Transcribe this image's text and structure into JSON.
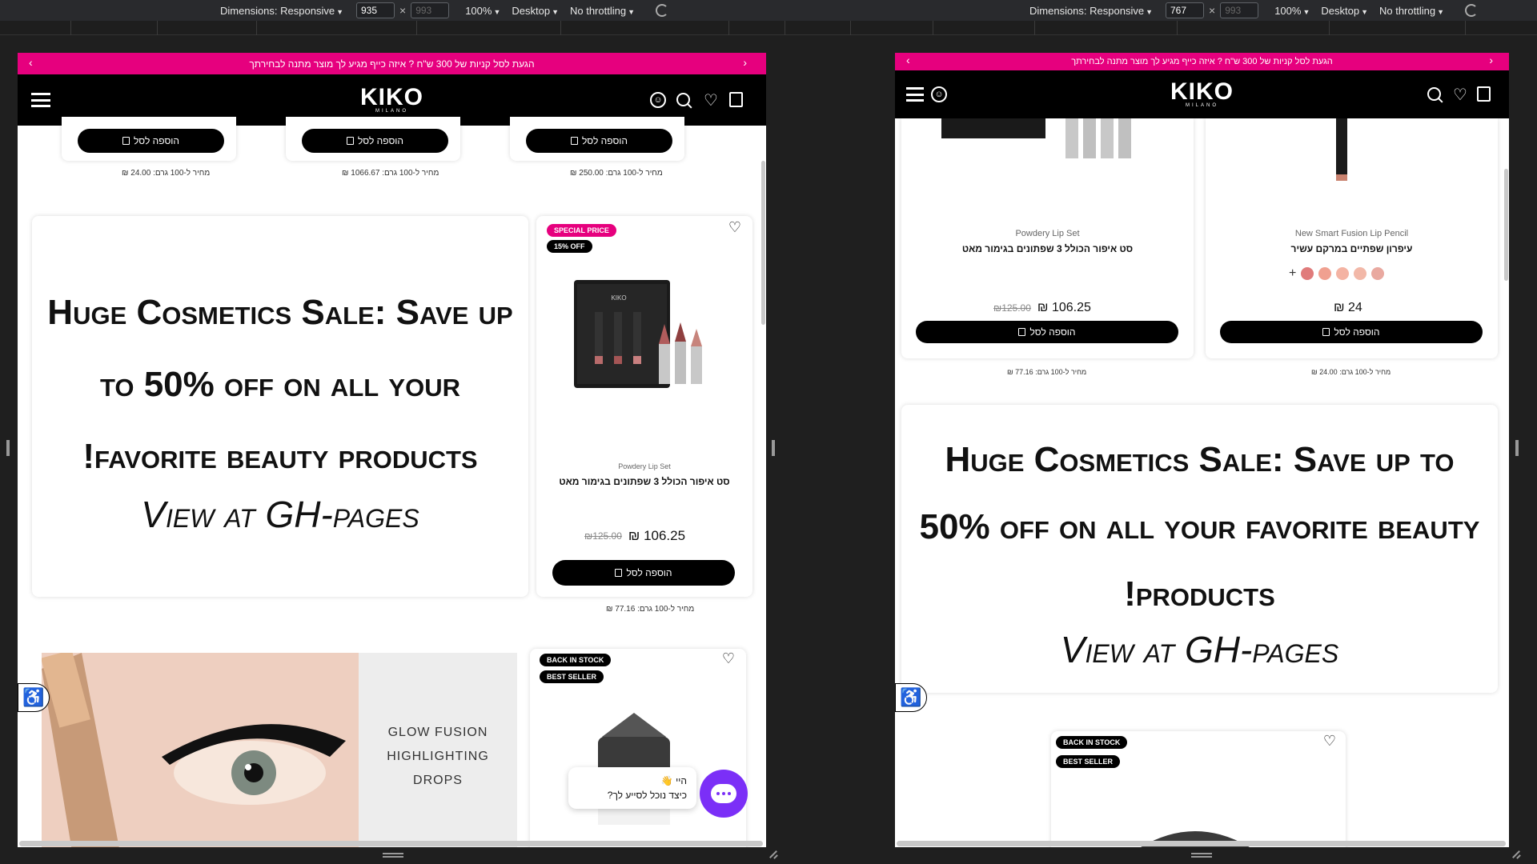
{
  "devtools": {
    "left": {
      "dimensions_label": "Dimensions: Responsive",
      "width": "935",
      "height": "993",
      "zoom": "100%",
      "device": "Desktop",
      "throttling": "No throttling"
    },
    "right": {
      "dimensions_label": "Dimensions: Responsive",
      "width": "767",
      "height": "993",
      "zoom": "100%",
      "device": "Desktop",
      "throttling": "No throttling"
    }
  },
  "site": {
    "promo_text": "הגעת לסל קניות של 300 ש\"ח ? איזה כייף מגיע לך מוצר מתנה לבחירתך",
    "logo": "KIKO",
    "logo_sub": "MILANO",
    "add_to_cart": "הוספה לסל",
    "banner_headline": "Huge Cosmetics Sale: Save up to 50% off on all your favorite beauty products!",
    "banner_link": "View at GH-pages",
    "badges": {
      "special_price": "SPECIAL PRICE",
      "off": "15% OFF",
      "back_in_stock": "BACK IN STOCK",
      "best_seller": "BEST SELLER"
    },
    "chat_greeting_line1": "היי 👋",
    "chat_greeting_line2": "כיצד נוכל לסייע לך?",
    "glow_line1": "GLOW FUSION",
    "glow_line2": "HIGHLIGHTING",
    "glow_line3": "DROPS",
    "accessibility_icon": "wheelchair-icon"
  },
  "left_view": {
    "top_unit_prices": [
      "מחיר ל-100 גרם: 24.00 ₪",
      "מחיר ל-100 גרם: 1066.67 ₪",
      "מחיר ל-100 גרם: 250.00 ₪"
    ],
    "product": {
      "sub_name": "Powdery Lip Set",
      "name": "סט איפור הכולל 3 שפתונים בגימור מאט",
      "old_price": "₪125.00",
      "new_price": "₪ 106.25",
      "unit_price": "מחיר ל-100 גרם: 77.16 ₪"
    }
  },
  "right_view": {
    "products": [
      {
        "sub_name": "Powdery Lip Set",
        "name": "סט איפור הכולל 3 שפתונים בגימור מאט",
        "old_price": "₪125.00",
        "new_price": "₪ 106.25",
        "unit_price": "מחיר ל-100 גרם: 77.16 ₪"
      },
      {
        "sub_name": "New Smart Fusion Lip Pencil",
        "name": "עיפרון שפתיים במרקם עשיר",
        "new_price": "₪ 24",
        "unit_price": "מחיר ל-100 גרם: 24.00 ₪"
      }
    ],
    "swatch_colors": [
      "#e07b7b",
      "#f0a090",
      "#f4b3a3",
      "#f2b8a8",
      "#e9a9a0"
    ]
  }
}
